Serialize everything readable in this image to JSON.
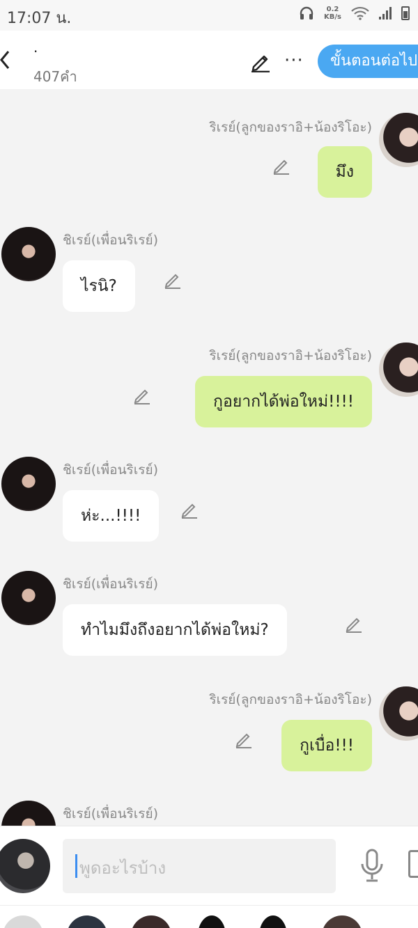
{
  "status_bar": {
    "time": "17:07 น.",
    "net_speed_value": "0.2",
    "net_speed_unit": "KB/s",
    "battery": "56"
  },
  "header": {
    "title": "·",
    "word_count": "407คำ",
    "next_button": "ขั้นตอนต่อไป"
  },
  "messages": [
    {
      "side": "right",
      "sender": "ริเรย์(ลูกของราอิ+น้องริโอะ)",
      "text": "มึง"
    },
    {
      "side": "left",
      "sender": "ชิเรย์(เพื่อนริเรย์)",
      "text": "ไรนิ?"
    },
    {
      "side": "right",
      "sender": "ริเรย์(ลูกของราอิ+น้องริโอะ)",
      "text": "กูอยากได้พ่อใหม่!!!!"
    },
    {
      "side": "left",
      "sender": "ชิเรย์(เพื่อนริเรย์)",
      "text": "ห่ะ...!!!!"
    },
    {
      "side": "left",
      "sender": "ชิเรย์(เพื่อนริเรย์)",
      "text": "ทำไมมึงถึงอยากได้พ่อใหม่?"
    },
    {
      "side": "right",
      "sender": "ริเรย์(ลูกของราอิ+น้องริโอะ)",
      "text": "กูเบื่อ!!!"
    },
    {
      "side": "left",
      "sender": "ชิเรย์(เพื่อนริเรย์)",
      "text": ""
    }
  ],
  "input": {
    "placeholder": "พูดอะไรบ้าง",
    "value": ""
  },
  "colors": {
    "accent": "#4aa8f2",
    "bubble_right": "#d8f29b",
    "bubble_left": "#ffffff",
    "background": "#f3f3f3"
  },
  "icons": [
    "back-icon",
    "pen-icon",
    "more-icon",
    "edit-icon",
    "mic-icon",
    "image-icon",
    "headphones-icon",
    "wifi-icon",
    "signal-icon",
    "battery-icon"
  ]
}
